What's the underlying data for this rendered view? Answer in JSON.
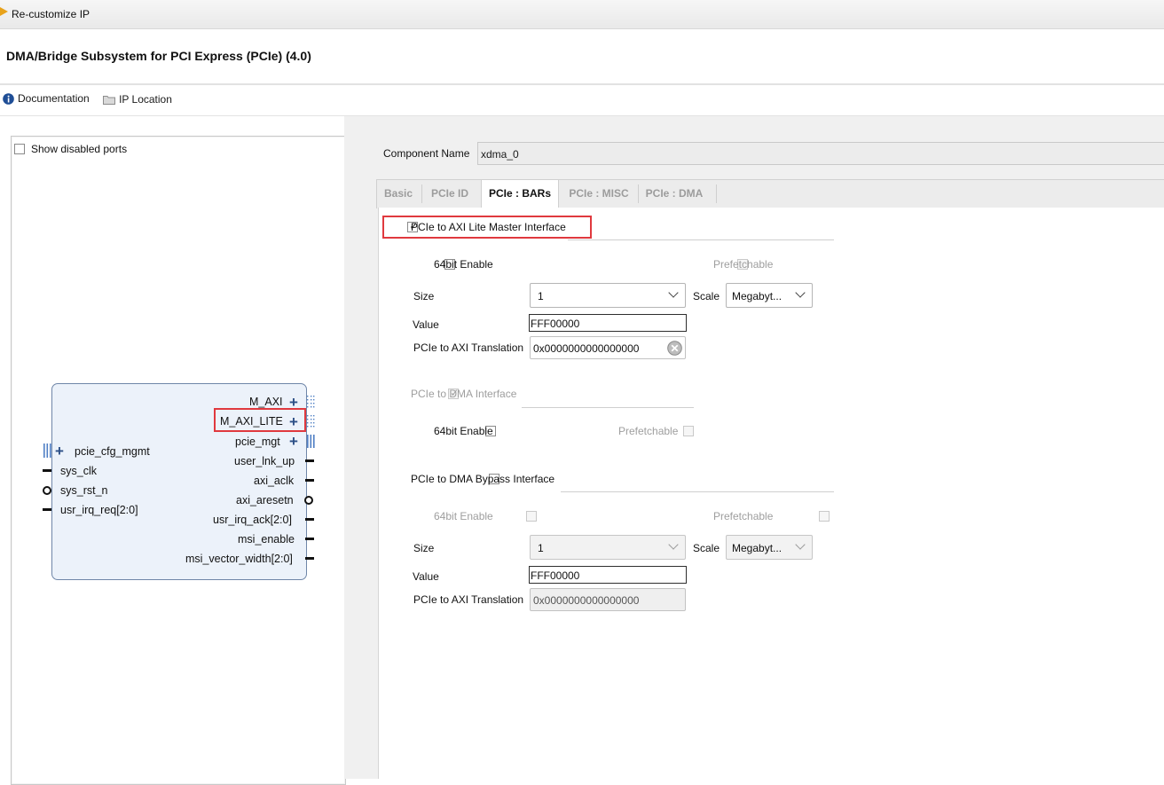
{
  "window": {
    "title": "Re-customize IP"
  },
  "heading": "DMA/Bridge Subsystem for PCI Express (PCIe) (4.0)",
  "toolbar": {
    "documentation": "Documentation",
    "ip_location": "IP Location"
  },
  "left": {
    "show_disabled_ports": "Show disabled ports",
    "show_disabled_checked": false,
    "right_ports": [
      "M_AXI",
      "M_AXI_LITE",
      "pcie_mgt",
      "user_lnk_up",
      "axi_aclk",
      "axi_aresetn",
      "usr_irq_ack[2:0]",
      "msi_enable",
      "msi_vector_width[2:0]"
    ],
    "left_ports": [
      "pcie_cfg_mgmt",
      "sys_clk",
      "sys_rst_n",
      "usr_irq_req[2:0]"
    ]
  },
  "component": {
    "label": "Component Name",
    "value": "xdma_0"
  },
  "tabs": [
    "Basic",
    "PCIe ID",
    "PCIe : BARs",
    "PCIe : MISC",
    "PCIe : DMA"
  ],
  "active_tab": "PCIe : BARs",
  "bars": {
    "axi_lite": {
      "label": "PCIe to AXI Lite Master Interface",
      "checked": true,
      "bit64": "64bit Enable",
      "prefetch": "Prefetchable",
      "size_label": "Size",
      "size_value": "1",
      "scale_label": "Scale",
      "scale_value": "Megabyt...",
      "value_label": "Value",
      "value": "FFF00000",
      "translation_label": "PCIe to AXI Translation",
      "translation_value": "0x0000000000000000"
    },
    "dma": {
      "label": "PCIe to DMA Interface",
      "checked": true,
      "bit64": "64bit Enable",
      "prefetch": "Prefetchable"
    },
    "bypass": {
      "label": "PCIe to DMA Bypass Interface",
      "checked": false,
      "bit64": "64bit Enable",
      "prefetch": "Prefetchable",
      "size_label": "Size",
      "size_value": "1",
      "scale_label": "Scale",
      "scale_value": "Megabyt...",
      "value_label": "Value",
      "value": "FFF00000",
      "translation_label": "PCIe to AXI Translation",
      "translation_value": "0x0000000000000000"
    }
  },
  "colors": {
    "highlight": "#e0393e",
    "block_fill": "#ecf2fa",
    "block_border": "#6f86a8",
    "plus": "#2c4f86"
  }
}
